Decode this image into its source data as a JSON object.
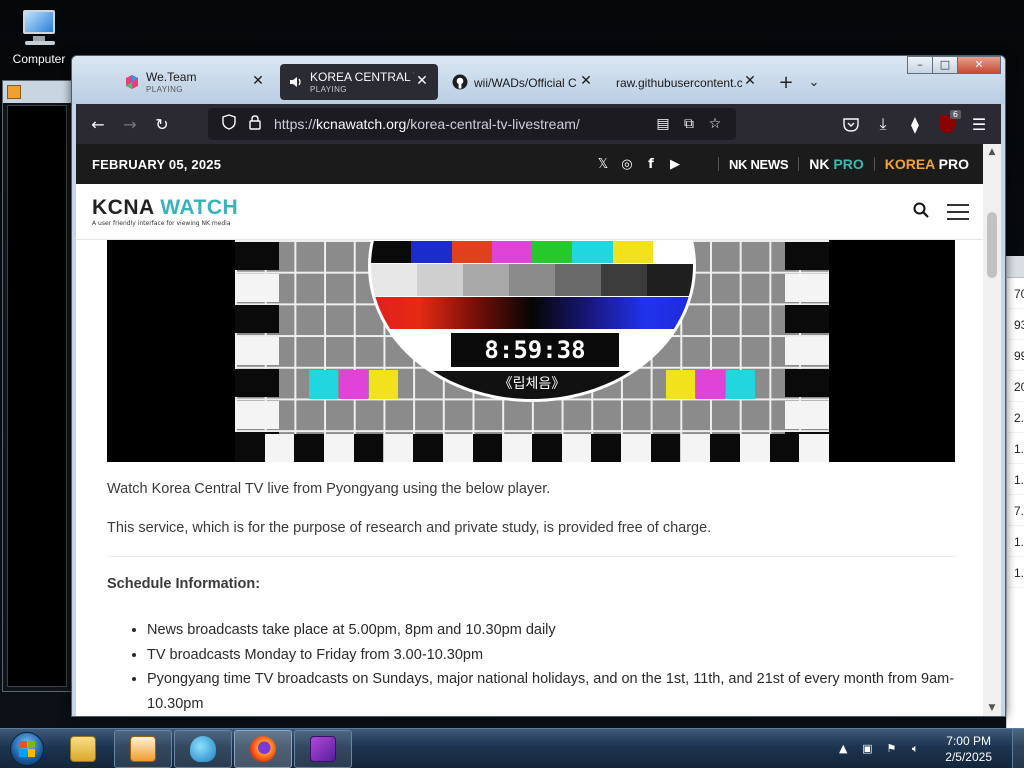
{
  "desktop": {
    "icon_label": "Computer",
    "right_window_cells": [
      "70",
      "93",
      "99",
      "20",
      "2.",
      "1.",
      "1.",
      "7.",
      "1.",
      "1."
    ]
  },
  "browser": {
    "tabs": [
      {
        "title": "We.Team",
        "status": "PLAYING",
        "icon": "weteam-icon",
        "close": "✕",
        "active": false
      },
      {
        "title": "KOREA CENTRAL TV",
        "status": "PLAYING",
        "icon": "speaker-icon",
        "close": "✕",
        "active": true
      },
      {
        "title": "wii/WADs/Official C",
        "status": "",
        "icon": "github-icon",
        "close": "✕",
        "active": false
      },
      {
        "title": "raw.githubusercontent.c",
        "status": "",
        "icon": "",
        "close": "✕",
        "active": false
      }
    ],
    "new_tab": "+",
    "tab_list": "⌄",
    "url_prefix": "https://",
    "url_domain": "kcnawatch.org",
    "url_path": "/korea-central-tv-livestream/",
    "extension_badge": "6"
  },
  "site": {
    "date": "FEBRUARY 05, 2025",
    "brand_nknews": "NK NEWS",
    "brand_nkpro_a": "NK",
    "brand_nkpro_b": "PRO",
    "brand_korea_a": "KOREA",
    "brand_korea_b": "PRO",
    "logo_a": "KCNA",
    "logo_b": "WATCH",
    "logo_tagline": "A user friendly interface for viewing NK media"
  },
  "video": {
    "clock": "8:59:38",
    "caption": "《립체음》",
    "colors_top": [
      "#0a0a0a",
      "#1c2ccc",
      "#e0401c",
      "#e043d8",
      "#25c92c",
      "#22d6e0",
      "#f2e21c",
      "#ffffff"
    ],
    "colors_gray": [
      "#e6e6e6",
      "#cfcfcf",
      "#a8a8a8",
      "#8b8b8b",
      "#6a6a6a",
      "#3c3c3c",
      "#1f1f1f"
    ]
  },
  "content": {
    "intro": "Watch Korea Central TV live from Pyongyang using the below player.",
    "notice": "This service, which is for the purpose of research and private study, is provided free of charge.",
    "schedule_heading": "Schedule Information:",
    "schedule": [
      "News broadcasts take place at 5.00pm, 8pm and 10.30pm daily",
      "TV broadcasts Monday to Friday from 3.00-10.30pm",
      "Pyongyang time TV broadcasts on Sundays, major national holidays, and on the 1st, 11th, and 21st of every month from 9am-10.30pm"
    ]
  },
  "taskbar": {
    "time": "7:00 PM",
    "date": "2/5/2025"
  }
}
